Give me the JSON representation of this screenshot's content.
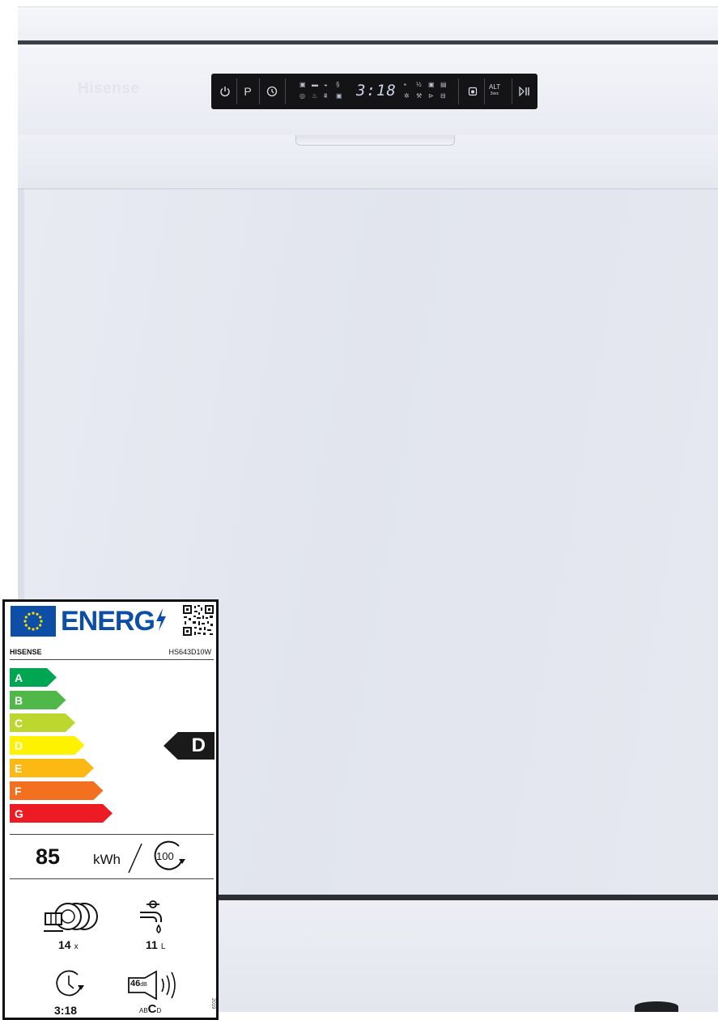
{
  "appliance": {
    "brand": "Hisense",
    "display": {
      "time": "3:18",
      "program_button": "P",
      "alt_button": "ALT",
      "alt_sub": "3sec"
    }
  },
  "energy_label": {
    "header": "ENERG",
    "supplier": "HISENSE",
    "model": "HS643D10W",
    "scale": [
      {
        "letter": "A",
        "color": "#00a651"
      },
      {
        "letter": "B",
        "color": "#50b848"
      },
      {
        "letter": "C",
        "color": "#bdd630"
      },
      {
        "letter": "D",
        "color": "#fff200"
      },
      {
        "letter": "E",
        "color": "#fdb913"
      },
      {
        "letter": "F",
        "color": "#f37021"
      },
      {
        "letter": "G",
        "color": "#ed1c24"
      }
    ],
    "rating": "D",
    "energy_value": "85",
    "energy_unit": "kWh",
    "cycles": "100",
    "place_settings": "14",
    "place_settings_unit": "x",
    "water_value": "11",
    "water_unit": "L",
    "duration": "3:18",
    "noise_value": "46",
    "noise_unit": "dB",
    "noise_class_pre": "AB",
    "noise_class": "C",
    "noise_class_post": "D",
    "regulation_year": "2019"
  }
}
